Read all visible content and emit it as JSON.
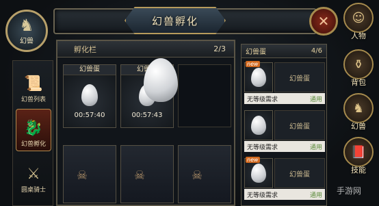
{
  "title": "幻兽孵化",
  "emblem": {
    "label": "幻兽"
  },
  "left_nav": [
    {
      "label": "幻兽列表",
      "icon": "scroll-icon"
    },
    {
      "label": "幻兽孵化",
      "icon": "dragon-icon",
      "active": true
    },
    {
      "label": "圆桌骑士",
      "icon": "swords-icon"
    }
  ],
  "hatch": {
    "header": "孵化栏",
    "count": "2/3",
    "slots": [
      {
        "title": "幻兽蛋",
        "timer": "00:57:40"
      },
      {
        "title": "幻兽蛋",
        "timer": "00:57:43"
      }
    ]
  },
  "eggs_list": {
    "header": "幻兽蛋",
    "count": "4/6",
    "items": [
      {
        "badge": "new",
        "name": "幻兽蛋",
        "requirement": "无等级需求",
        "status": "通用"
      },
      {
        "badge": "",
        "name": "幻兽蛋",
        "requirement": "无等级需求",
        "status": "通用"
      },
      {
        "badge": "new",
        "name": "幻兽蛋",
        "requirement": "无等级需求",
        "status": "通用"
      }
    ]
  },
  "right_nav": [
    {
      "label": "人物"
    },
    {
      "label": "背包"
    },
    {
      "label": "幻兽"
    },
    {
      "label": "技能"
    }
  ],
  "watermark": "手游网"
}
